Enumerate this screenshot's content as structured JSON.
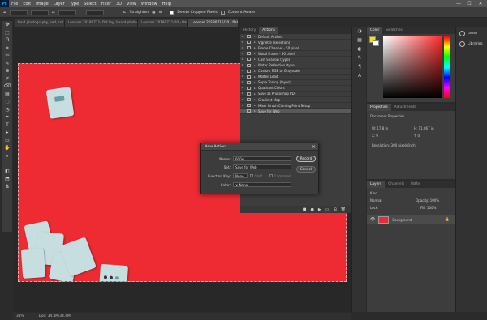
{
  "menu": [
    "File",
    "Edit",
    "Image",
    "Layer",
    "Type",
    "Select",
    "Filter",
    "3D",
    "View",
    "Window",
    "Help"
  ],
  "logo": "Ps",
  "window_controls": [
    "—",
    "☐",
    "✕"
  ],
  "options": {
    "straighten": "Straighten",
    "delete_cropped": "Delete Cropped Pixels",
    "content_aware": "Content-Aware"
  },
  "doc_tabs": [
    "food photography, red, cut deck.jpg",
    "Lessons 20180711- flat lay, board photography, red, cut deck.jpg",
    "Lessons 20180711/20 - flat...",
    "Leonore 20180716/20 - flat..."
  ],
  "tools": [
    "✥",
    "⬚",
    "ʘ",
    "⌗",
    "✄",
    "✎",
    "⊕",
    "✐",
    "⌫",
    "▤",
    "◌",
    "◔",
    "✒",
    "T",
    "▸",
    "▭",
    "✋",
    "⌕",
    "…",
    "◧",
    "⬒",
    "⇅"
  ],
  "actions_panel": {
    "tabs": [
      "History",
      "Actions"
    ],
    "rows": [
      {
        "label": "Default Actions",
        "chk": "✓",
        "sel": false
      },
      {
        "label": "Vignette (selection)",
        "chk": "✓",
        "sel": false
      },
      {
        "label": "Frame Channel - 50 pixel",
        "chk": "✓",
        "sel": false
      },
      {
        "label": "Wood Frame - 50 pixel",
        "chk": "✓",
        "sel": false
      },
      {
        "label": "Cast Shadow (type)",
        "chk": "✓",
        "sel": false
      },
      {
        "label": "Water Reflection (type)",
        "chk": "✓",
        "sel": false
      },
      {
        "label": "Custom RGB to Grayscale",
        "chk": "✓",
        "sel": false
      },
      {
        "label": "Molten Lead",
        "chk": "✓",
        "sel": false
      },
      {
        "label": "Sepia Toning (layer)",
        "chk": "✓",
        "sel": false
      },
      {
        "label": "Quadrant Colors",
        "chk": "✓",
        "sel": false
      },
      {
        "label": "Save as Photoshop PDF",
        "chk": "✓",
        "sel": false
      },
      {
        "label": "Gradient Map",
        "chk": "✓",
        "sel": false
      },
      {
        "label": "Mixer Brush Cloning Paint Setup",
        "chk": "✓",
        "sel": false
      },
      {
        "label": "Save for Web",
        "chk": "",
        "sel": true
      }
    ],
    "footer_icons": [
      "■",
      "●",
      "▶",
      "▭",
      "⊞",
      "🗑"
    ]
  },
  "dialog": {
    "title": "New Action",
    "name_label": "Name:",
    "name_value": "600w",
    "set_label": "Set:",
    "set_value": "Save for Web",
    "fkey_label": "Function Key:",
    "fkey_value": "None",
    "shift_label": "Shift",
    "command_label": "Command",
    "color_label": "Color:",
    "color_value": "None",
    "color_x": "✕",
    "record": "Record",
    "cancel": "Cancel"
  },
  "color_panel": {
    "tabs": [
      "Color",
      "Swatches"
    ]
  },
  "props_panel": {
    "tabs": [
      "Properties",
      "Adjustments"
    ],
    "heading": "Document Properties",
    "w": "W: 17.8 in",
    "h": "H: 11.867 in",
    "x": "X: 0",
    "y": "Y: 0",
    "res": "Resolution: 300 pixels/inch"
  },
  "layers_panel": {
    "tabs": [
      "Layers",
      "Channels",
      "Paths"
    ],
    "kind": "Kind",
    "mode": "Normal",
    "opacity": "Opacity: 100%",
    "lock": "Lock:",
    "fill": "Fill: 100%",
    "layer_name": "Background"
  },
  "libraries": [
    {
      "label": "Learn"
    },
    {
      "label": "Libraries"
    }
  ],
  "status": {
    "zoom": "33%",
    "doc": "Doc: 34.4M/34.4M"
  },
  "colors": {
    "photo_red": "#ee2a33",
    "card": "#c7dee0"
  }
}
